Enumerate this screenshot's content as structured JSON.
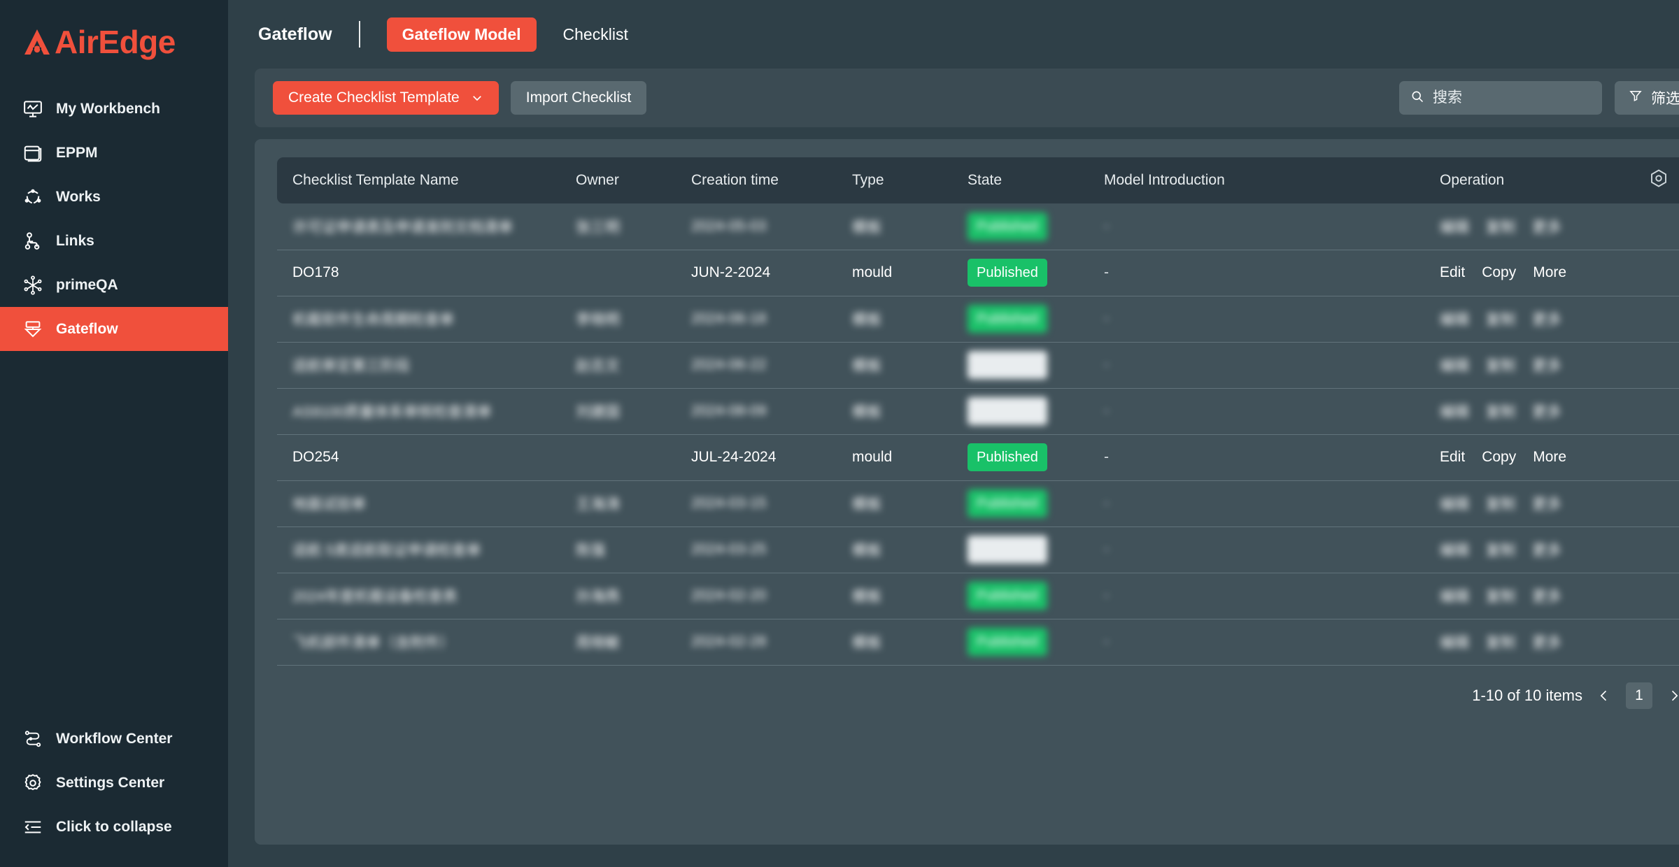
{
  "brand": {
    "name": "AirEdge"
  },
  "sidebar": {
    "items": [
      {
        "label": "My Workbench",
        "icon": "monitor-chart-icon",
        "active": false
      },
      {
        "label": "EPPM",
        "icon": "window-stack-icon",
        "active": false
      },
      {
        "label": "Works",
        "icon": "circle-nodes-icon",
        "active": false
      },
      {
        "label": "Links",
        "icon": "link-tree-icon",
        "active": false
      },
      {
        "label": "primeQA",
        "icon": "asterisk-nodes-icon",
        "active": false
      },
      {
        "label": "Gateflow",
        "icon": "gateflow-icon",
        "active": true
      }
    ],
    "bottom_items": [
      {
        "label": "Workflow Center",
        "icon": "workflow-icon"
      },
      {
        "label": "Settings Center",
        "icon": "gear-icon"
      },
      {
        "label": "Click to collapse",
        "icon": "collapse-icon"
      }
    ]
  },
  "header": {
    "title": "Gateflow",
    "tabs": [
      {
        "label": "Gateflow Model",
        "active": true
      },
      {
        "label": "Checklist",
        "active": false
      }
    ]
  },
  "toolbar": {
    "create_label": "Create Checklist Template",
    "import_label": "Import Checklist",
    "search_placeholder": "搜索",
    "search_value": "",
    "filter_label": "筛选"
  },
  "table": {
    "columns": [
      "Checklist Template Name",
      "Owner",
      "Creation time",
      "Type",
      "State",
      "Model Introduction",
      "Operation"
    ],
    "settings_icon": "column-settings-icon",
    "rows": [
      {
        "name": "许可证申请表及申请准则文档清单",
        "owner": "张三明",
        "time": "2024-05-03",
        "type": "模板",
        "state": "",
        "state_style": "green",
        "intro": "-",
        "blurred": true,
        "ops": [
          "编辑",
          "复制",
          "更多"
        ]
      },
      {
        "name": "DO178",
        "owner": "",
        "time": "JUN-2-2024",
        "type": "mould",
        "state": "Published",
        "state_style": "green",
        "intro": "-",
        "blurred": false,
        "ops": [
          "Edit",
          "Copy",
          "More"
        ]
      },
      {
        "name": "机载软件生命周期检查单",
        "owner": "李晓明",
        "time": "2024-06-18",
        "type": "模板",
        "state": "",
        "state_style": "green",
        "intro": "-",
        "blurred": true,
        "ops": [
          "编辑",
          "复制",
          "更多"
        ]
      },
      {
        "name": "适航审定第三阶段",
        "owner": "赵志文",
        "time": "2024-06-22",
        "type": "模板",
        "state": "",
        "state_style": "white",
        "intro": "-",
        "blurred": true,
        "ops": [
          "编辑",
          "复制",
          "更多"
        ]
      },
      {
        "name": "AS9100质量体系审核检查清单",
        "owner": "刘建国",
        "time": "2024-08-09",
        "type": "模板",
        "state": "",
        "state_style": "white",
        "intro": "-",
        "blurred": true,
        "ops": [
          "编辑",
          "复制",
          "更多"
        ]
      },
      {
        "name": "DO254",
        "owner": "",
        "time": "JUL-24-2024",
        "type": "mould",
        "state": "Published",
        "state_style": "green",
        "intro": "-",
        "blurred": false,
        "ops": [
          "Edit",
          "Copy",
          "More"
        ]
      },
      {
        "name": "地面试验单",
        "owner": "王海涛",
        "time": "2024-03-15",
        "type": "模板",
        "state": "",
        "state_style": "green",
        "intro": "-",
        "blurred": true,
        "ops": [
          "编辑",
          "复制",
          "更多"
        ]
      },
      {
        "name": "适航 5类适航取证申请检查单",
        "owner": "陈强",
        "time": "2024-03-25",
        "type": "模板",
        "state": "",
        "state_style": "white",
        "intro": "-",
        "blurred": true,
        "ops": [
          "编辑",
          "复制",
          "更多"
        ]
      },
      {
        "name": "2024年度机载设备检查表",
        "owner": "孙海燕",
        "time": "2024-02-20",
        "type": "模板",
        "state": "",
        "state_style": "green",
        "intro": "-",
        "blurred": true,
        "ops": [
          "编辑",
          "复制",
          "更多"
        ]
      },
      {
        "name": "飞机部件清单（含附件）",
        "owner": "周晓敏",
        "time": "2024-02-28",
        "type": "模板",
        "state": "",
        "state_style": "green",
        "intro": "-",
        "blurred": true,
        "ops": [
          "编辑",
          "复制",
          "更多"
        ]
      }
    ]
  },
  "pagination": {
    "summary": "1-10 of 10 items",
    "prev_icon": "chevron-left-icon",
    "next_icon": "chevron-right-icon",
    "current_page": "1"
  },
  "colors": {
    "accent": "#f0503c",
    "sidebar_bg": "#1b2a33",
    "main_bg": "#2f4048",
    "panel_bg": "#41525a",
    "toolbar_bg": "#3b4b53",
    "table_head_bg": "#2b3942",
    "badge_green": "#19c168",
    "badge_white": "#e9edef"
  }
}
